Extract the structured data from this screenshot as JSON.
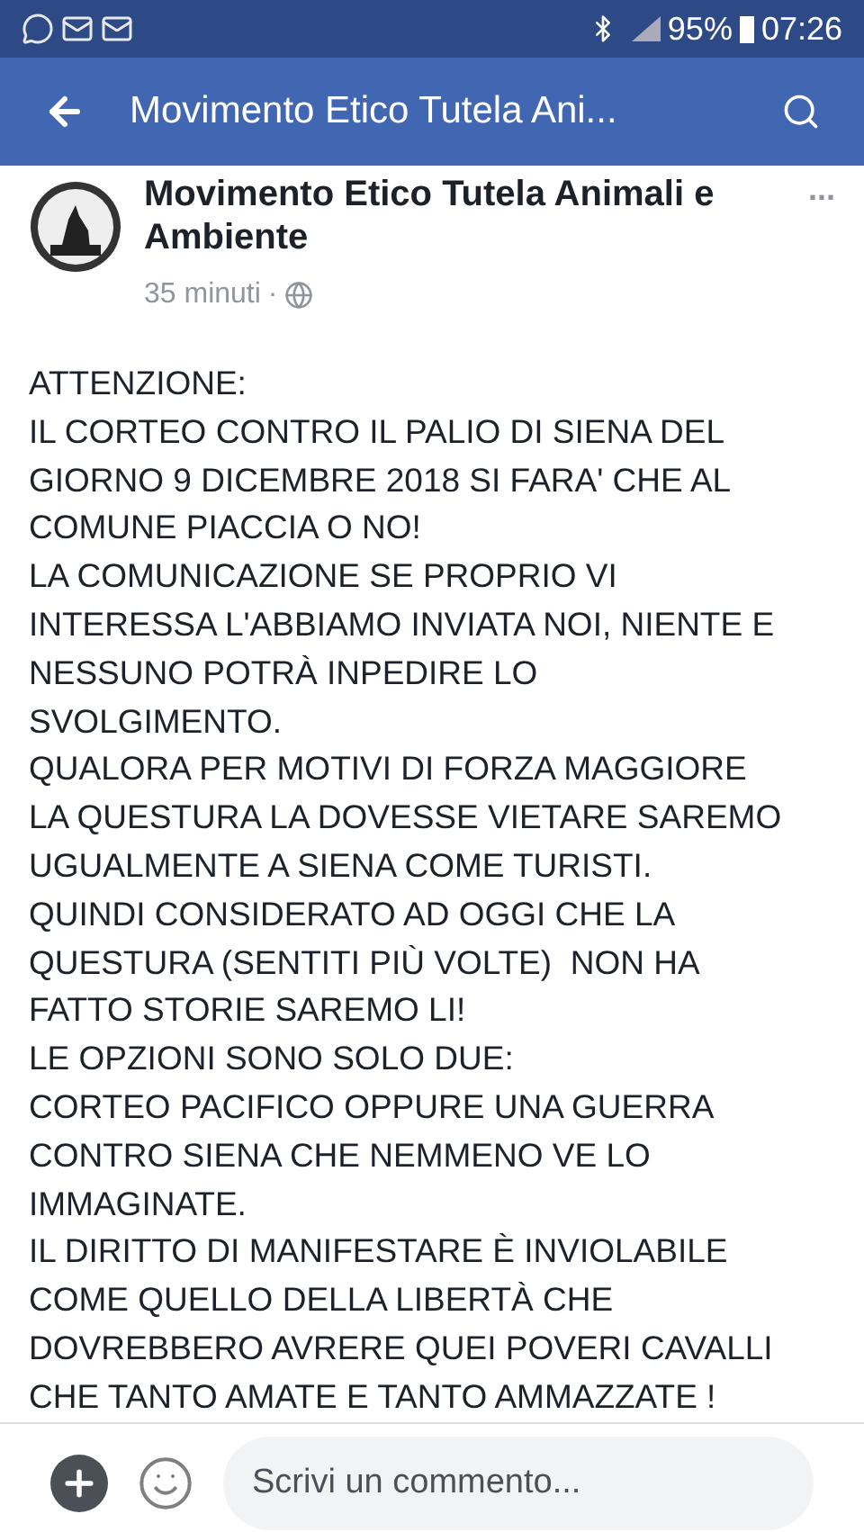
{
  "status_bar": {
    "battery": "95%",
    "time": "07:26"
  },
  "header": {
    "title": "Movimento Etico Tutela Ani..."
  },
  "post": {
    "author": "Movimento Etico Tutela Animali e Ambiente",
    "time": "35 minuti",
    "separator": "·",
    "more": "...",
    "lines": [
      "ATTENZIONE:",
      "IL CORTEO CONTRO IL PALIO DI SIENA DEL",
      "GIORNO 9 DICEMBRE 2018 SI FARA' CHE AL",
      "COMUNE PIACCIA O NO!",
      "LA COMUNICAZIONE SE PROPRIO VI",
      "INTERESSA L'ABBIAMO INVIATA NOI, NIENTE E",
      "NESSUNO POTRÀ INPEDIRE LO",
      "SVOLGIMENTO.",
      "QUALORA PER MOTIVI DI FORZA MAGGIORE",
      "LA QUESTURA LA DOVESSE VIETARE SAREMO",
      "UGUALMENTE A SIENA COME TURISTI.",
      "QUINDI CONSIDERATO AD OGGI CHE LA",
      "QUESTURA (SENTITI PIÙ VOLTE)  NON HA",
      "FATTO STORIE SAREMO LI!",
      "LE OPZIONI SONO SOLO DUE:",
      "CORTEO PACIFICO OPPURE UNA GUERRA",
      "CONTRO SIENA CHE NEMMENO VE LO",
      "IMMAGINATE.",
      "IL DIRITTO DI MANIFESTARE È INVIOLABILE",
      "COME QUELLO DELLA LIBERTÀ CHE",
      "DOVREBBERO AVRERE QUEI POVERI CAVALLI",
      "CHE TANTO AMATE E TANTO AMMAZZATE !"
    ]
  },
  "comment": {
    "placeholder": "Scrivi un commento..."
  }
}
